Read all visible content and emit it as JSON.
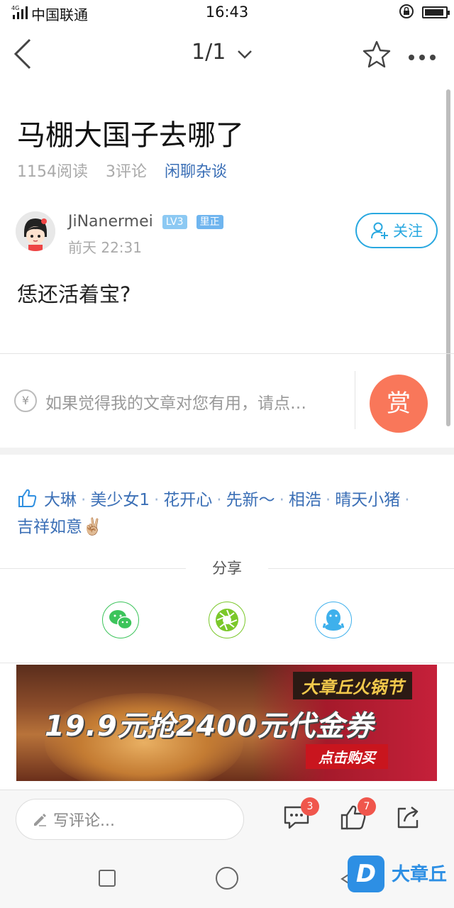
{
  "status_bar": {
    "network": "4G",
    "carrier": "中国联通",
    "time": "16:43"
  },
  "nav": {
    "pager": "1/1"
  },
  "post": {
    "title": "马棚大国子去哪了",
    "reads": "1154阅读",
    "comments": "3评论",
    "category": "闲聊杂谈",
    "author": {
      "name": "JiNanermei",
      "level_badge": "LV3",
      "area_badge": "里正",
      "date": "前天 22:31",
      "follow_label": "关注"
    },
    "content": "恁还活着宝?"
  },
  "tip": {
    "placeholder": "如果觉得我的文章对您有用，请点…",
    "reward_label": "赏",
    "currency": "¥"
  },
  "likes": {
    "users": [
      "大琳",
      "美少女1",
      "花开心",
      "先新～",
      "相浩",
      "晴天小猪",
      "吉祥如意✌🏼"
    ],
    "separator": "·"
  },
  "share": {
    "label": "分享",
    "targets": [
      "wechat-icon",
      "moments-icon",
      "qq-icon"
    ]
  },
  "banner": {
    "tag": "大章丘火锅节",
    "headline": "19.9元抢2400元代金券",
    "cta": "点击购买"
  },
  "bottom_bar": {
    "comment_placeholder": "写评论...",
    "comment_count": "3",
    "like_count": "7"
  },
  "watermark": {
    "logo": "D",
    "text": "大章丘"
  },
  "colors": {
    "accent": "#29a8e0",
    "link": "#3b6fb6",
    "reward": "#f9775a",
    "badge": "#f0564c",
    "brand": "#2d8fe4"
  }
}
